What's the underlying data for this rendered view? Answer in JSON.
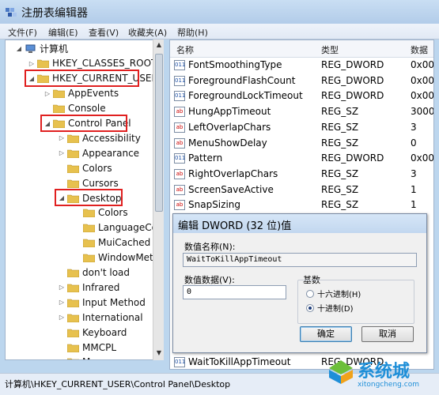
{
  "window": {
    "title": "注册表编辑器"
  },
  "menu": [
    "文件(F)",
    "编辑(E)",
    "查看(V)",
    "收藏夹(A)",
    "帮助(H)"
  ],
  "tree": {
    "nodes": [
      {
        "label": "计算机",
        "expander": "◢",
        "level": 0
      },
      {
        "label": "HKEY_CLASSES_ROOT",
        "expander": "▷",
        "level": 1
      },
      {
        "label": "HKEY_CURRENT_USER",
        "expander": "◢",
        "level": 1,
        "highlight": true
      },
      {
        "label": "AppEvents",
        "expander": "▷",
        "level": 2
      },
      {
        "label": "Console",
        "expander": "",
        "level": 2
      },
      {
        "label": "Control Panel",
        "expander": "◢",
        "level": 2,
        "highlight": true
      },
      {
        "label": "Accessibility",
        "expander": "▷",
        "level": 3
      },
      {
        "label": "Appearance",
        "expander": "▷",
        "level": 3
      },
      {
        "label": "Colors",
        "expander": "",
        "level": 3
      },
      {
        "label": "Cursors",
        "expander": "",
        "level": 3
      },
      {
        "label": "Desktop",
        "expander": "◢",
        "level": 3,
        "highlight": true
      },
      {
        "label": "Colors",
        "expander": "",
        "level": 4
      },
      {
        "label": "LanguageCo",
        "expander": "",
        "level": 4
      },
      {
        "label": "MuiCached",
        "expander": "",
        "level": 4
      },
      {
        "label": "WindowMetr",
        "expander": "",
        "level": 4
      },
      {
        "label": "don't load",
        "expander": "",
        "level": 3
      },
      {
        "label": "Infrared",
        "expander": "▷",
        "level": 3
      },
      {
        "label": "Input Method",
        "expander": "▷",
        "level": 3
      },
      {
        "label": "International",
        "expander": "▷",
        "level": 3
      },
      {
        "label": "Keyboard",
        "expander": "",
        "level": 3
      },
      {
        "label": "MMCPL",
        "expander": "",
        "level": 3
      },
      {
        "label": "Mouse",
        "expander": "",
        "level": 3
      }
    ]
  },
  "list": {
    "columns": [
      "名称",
      "类型",
      "数据"
    ],
    "rows": [
      {
        "name": "FontSmoothingType",
        "type": "REG_DWORD",
        "data": "0x00",
        "kind": "bin"
      },
      {
        "name": "ForegroundFlashCount",
        "type": "REG_DWORD",
        "data": "0x00",
        "kind": "bin"
      },
      {
        "name": "ForegroundLockTimeout",
        "type": "REG_DWORD",
        "data": "0x00",
        "kind": "bin"
      },
      {
        "name": "HungAppTimeout",
        "type": "REG_SZ",
        "data": "3000",
        "kind": "ab"
      },
      {
        "name": "LeftOverlapChars",
        "type": "REG_SZ",
        "data": "3",
        "kind": "ab"
      },
      {
        "name": "MenuShowDelay",
        "type": "REG_SZ",
        "data": "0",
        "kind": "ab"
      },
      {
        "name": "Pattern",
        "type": "REG_DWORD",
        "data": "0x00",
        "kind": "bin"
      },
      {
        "name": "RightOverlapChars",
        "type": "REG_SZ",
        "data": "3",
        "kind": "ab"
      },
      {
        "name": "ScreenSaveActive",
        "type": "REG_SZ",
        "data": "1",
        "kind": "ab"
      },
      {
        "name": "SnapSizing",
        "type": "REG_SZ",
        "data": "1",
        "kind": "ab"
      }
    ],
    "last_row": {
      "name": "WaitToKillAppTimeout",
      "type": "REG_DWORD",
      "kind": "bin"
    }
  },
  "dialog": {
    "title": "编辑 DWORD (32 位)值",
    "name_label": "数值名称(N):",
    "name_value": "WaitToKillAppTimeout",
    "data_label": "数值数据(V):",
    "data_value": "0",
    "base_label": "基数",
    "hex_label": "十六进制(H)",
    "dec_label": "十进制(D)",
    "base_selected": "dec",
    "ok": "确定",
    "cancel": "取消"
  },
  "status": "计算机\\HKEY_CURRENT_USER\\Control Panel\\Desktop",
  "watermark": {
    "name": "系统城",
    "url": "xitongcheng.com"
  },
  "colors": {
    "highlight_box": "#e02020",
    "folder": "#e7c14e",
    "accent": "#1f8fd8"
  }
}
